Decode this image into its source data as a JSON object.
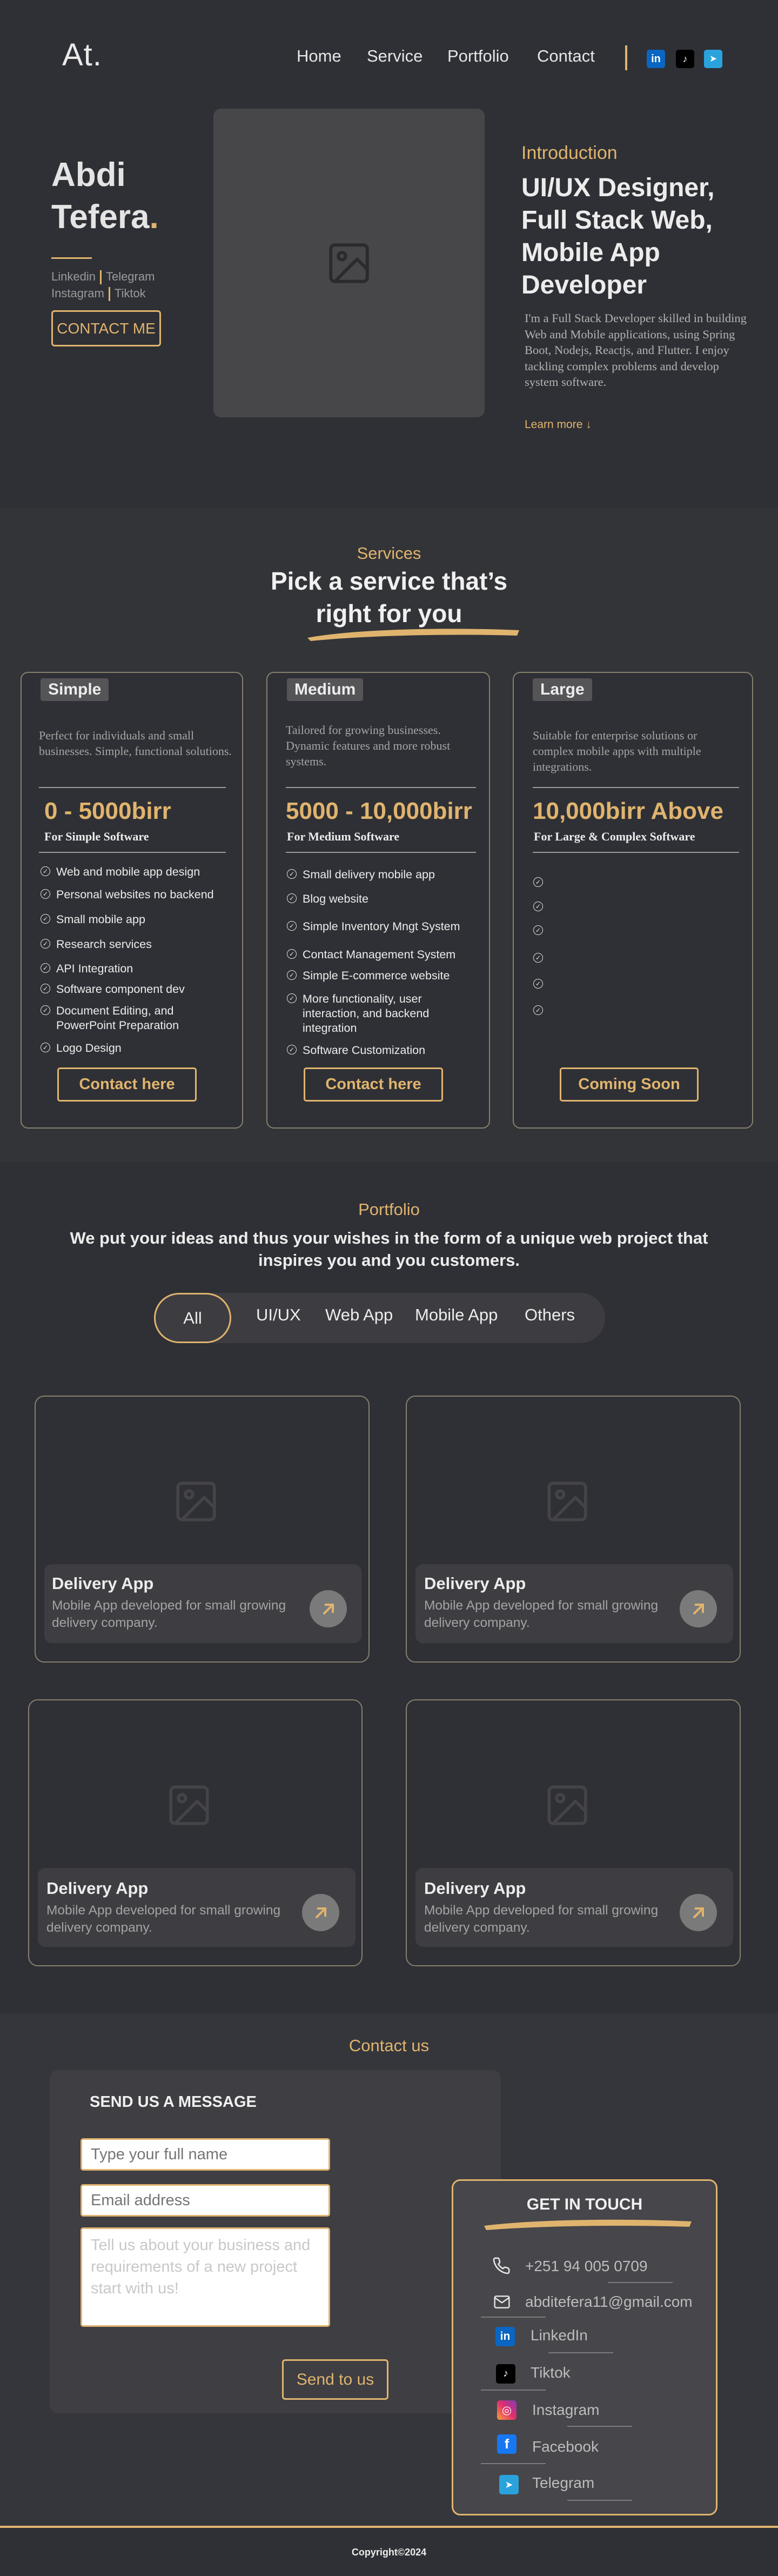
{
  "nav": {
    "logo": "At.",
    "items": [
      "Home",
      "Service",
      "Portfolio",
      "Contact"
    ],
    "social_icons": [
      "linkedin-icon",
      "tiktok-icon",
      "telegram-icon"
    ],
    "social_glyphs": [
      "in",
      "♪",
      "➤"
    ]
  },
  "hero": {
    "first_name": "Abdi",
    "last_name": "Tefera",
    "dot": ".",
    "links": [
      "Linkedin",
      "Telegram",
      "Instagram",
      "Tiktok"
    ],
    "cta": "CONTACT ME",
    "intro_label": "Introduction",
    "intro_title": "UI/UX Designer, Full Stack Web, Mobile App Developer",
    "intro_text": "I'm a Full Stack Developer skilled in building Web and Mobile applications, using Spring Boot, Nodejs, Reactjs, and Flutter.  I enjoy tackling complex problems and develop system software.",
    "learn_more": "Learn more ↓"
  },
  "services": {
    "label": "Services",
    "title_line1": "Pick a service that’s",
    "title_line2": "right for you",
    "cards": [
      {
        "tag": "Simple",
        "desc": "Perfect for individuals and small businesses. Simple, functional solutions.",
        "price": "0 - 5000birr",
        "sub": "For Simple Software",
        "features": [
          "Web and mobile app design",
          "Personal websites no backend",
          "Small  mobile app",
          "Research services",
          "API Integration",
          "Software component dev",
          "Document Editing, and PowerPoint Preparation",
          "Logo Design"
        ],
        "button": "Contact here"
      },
      {
        "tag": "Medium",
        "desc": "Tailored for growing businesses. Dynamic features and more robust systems.",
        "price": "5000 - 10,000birr",
        "sub": "For Medium Software",
        "features": [
          "Small delivery mobile app",
          "Blog website",
          "Simple Inventory Mngt System",
          "Contact Management System",
          "Simple E-commerce website",
          "More functionality, user interaction, and backend integration",
          "Software Customization"
        ],
        "button": "Contact here"
      },
      {
        "tag": "Large",
        "desc": "Suitable for enterprise solutions or complex mobile apps with multiple integrations.",
        "price": "10,000birr Above",
        "sub": "For Large & Complex Software",
        "features": [
          "",
          "",
          "",
          "",
          "",
          ""
        ],
        "button": "Coming Soon"
      }
    ]
  },
  "portfolio": {
    "label": "Portfolio",
    "subtitle_line1": "We put your ideas and thus your wishes in the form of a unique web project that",
    "subtitle_line2": "inspires you and you customers.",
    "filters": [
      "All",
      "UI/UX",
      "Web App",
      "Mobile App",
      "Others"
    ],
    "active_filter": "All",
    "projects": [
      {
        "title": "Delivery App",
        "desc_line1": "Mobile App developed for small growing",
        "desc_line2": "delivery company."
      },
      {
        "title": "Delivery App",
        "desc_line1": "Mobile App developed for small growing",
        "desc_line2": "delivery company."
      },
      {
        "title": "Delivery App",
        "desc_line1": "Mobile App developed for small growing",
        "desc_line2": "delivery company."
      },
      {
        "title": "Delivery App",
        "desc_line1": "Mobile App developed for small growing",
        "desc_line2": "delivery company."
      }
    ]
  },
  "contact": {
    "label": "Contact us",
    "form_title": "SEND US A MESSAGE",
    "name_placeholder": "Type your full name",
    "email_placeholder": "Email address",
    "message_placeholder": "Tell us about your business and requirements of a new project start with us!",
    "send_button": "Send to us",
    "git_title": "GET IN TOUCH",
    "phone": "+251 94 005 0709",
    "email": "abditefera11@gmail.com",
    "socials": [
      "LinkedIn",
      "Tiktok",
      "Instagram",
      "Facebook",
      "Telegram"
    ],
    "social_icons": [
      "linkedin-icon",
      "tiktok-icon",
      "instagram-icon",
      "facebook-icon",
      "telegram-icon"
    ],
    "social_glyphs": [
      "in",
      "♪",
      "◎",
      "f",
      "➤"
    ],
    "contact_icons": [
      "phone-icon",
      "mail-icon"
    ]
  },
  "footer": {
    "copyright": "Copyright©2024"
  },
  "colors": {
    "background": "#2f3035",
    "accent": "#e0b46e",
    "card": "#3e3e42"
  }
}
